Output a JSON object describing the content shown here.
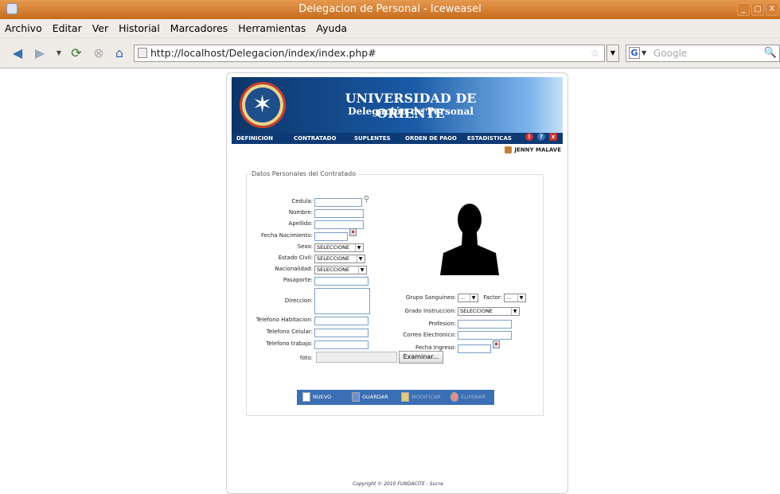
{
  "window": {
    "title": "Delegacion de Personal - Iceweasel",
    "controls": [
      "_",
      "▢",
      "X"
    ]
  },
  "menu": [
    "Archivo",
    "Editar",
    "Ver",
    "Historial",
    "Marcadores",
    "Herramientas",
    "Ayuda"
  ],
  "navbar": {
    "url": "http://localhost/Delegacion/index/index.php#",
    "search_placeholder": "Google"
  },
  "banner": {
    "title": "UNIVERSIDAD DE ORIENTE",
    "subtitle": "Delegación de Personal"
  },
  "nav": [
    "DEFINICION",
    "CONTRATADO",
    "SUPLENTES",
    "ORDEN DE PAGO",
    "ESTADISTICAS"
  ],
  "user": "JENNY MALAVE",
  "form": {
    "legend": "Datos Personales del Contratado",
    "cedula": "Cedula:",
    "nombre": "Nombre:",
    "apellido": "Apellido:",
    "fecha_nacimiento": "Fecha Nacimiento:",
    "sexo": "Sexo:",
    "estado_civil": "Estado Civil:",
    "nacionalidad": "Nacionalidad:",
    "pasaporte": "Pasaporte:",
    "direccion": "Direccion:",
    "tel_habitacion": "Telefono Habitacion:",
    "tel_celular": "Telefono Celular:",
    "tel_trabajo": "Telefono trabajo:",
    "foto": "foto:",
    "grupo_sanguineo": "Grupo Sanguineo:",
    "factor": "Factor:",
    "grado_instruccion": "Grado Instruccion:",
    "profesion": "Profesion:",
    "correo": "Correo Electronico:",
    "fecha_ingreso": "Fecha Ingreso:",
    "select_default": "SELECCIONE",
    "select_small": "...",
    "browse": "Examinar..."
  },
  "actions": {
    "nuevo": "NUEVO",
    "guardar": "GUARDAR",
    "modificar": "MODIFICAR",
    "eliminar": "ELIMINAR"
  },
  "copyright": "Copyright © 2010 FUNDACITE - Sucre"
}
